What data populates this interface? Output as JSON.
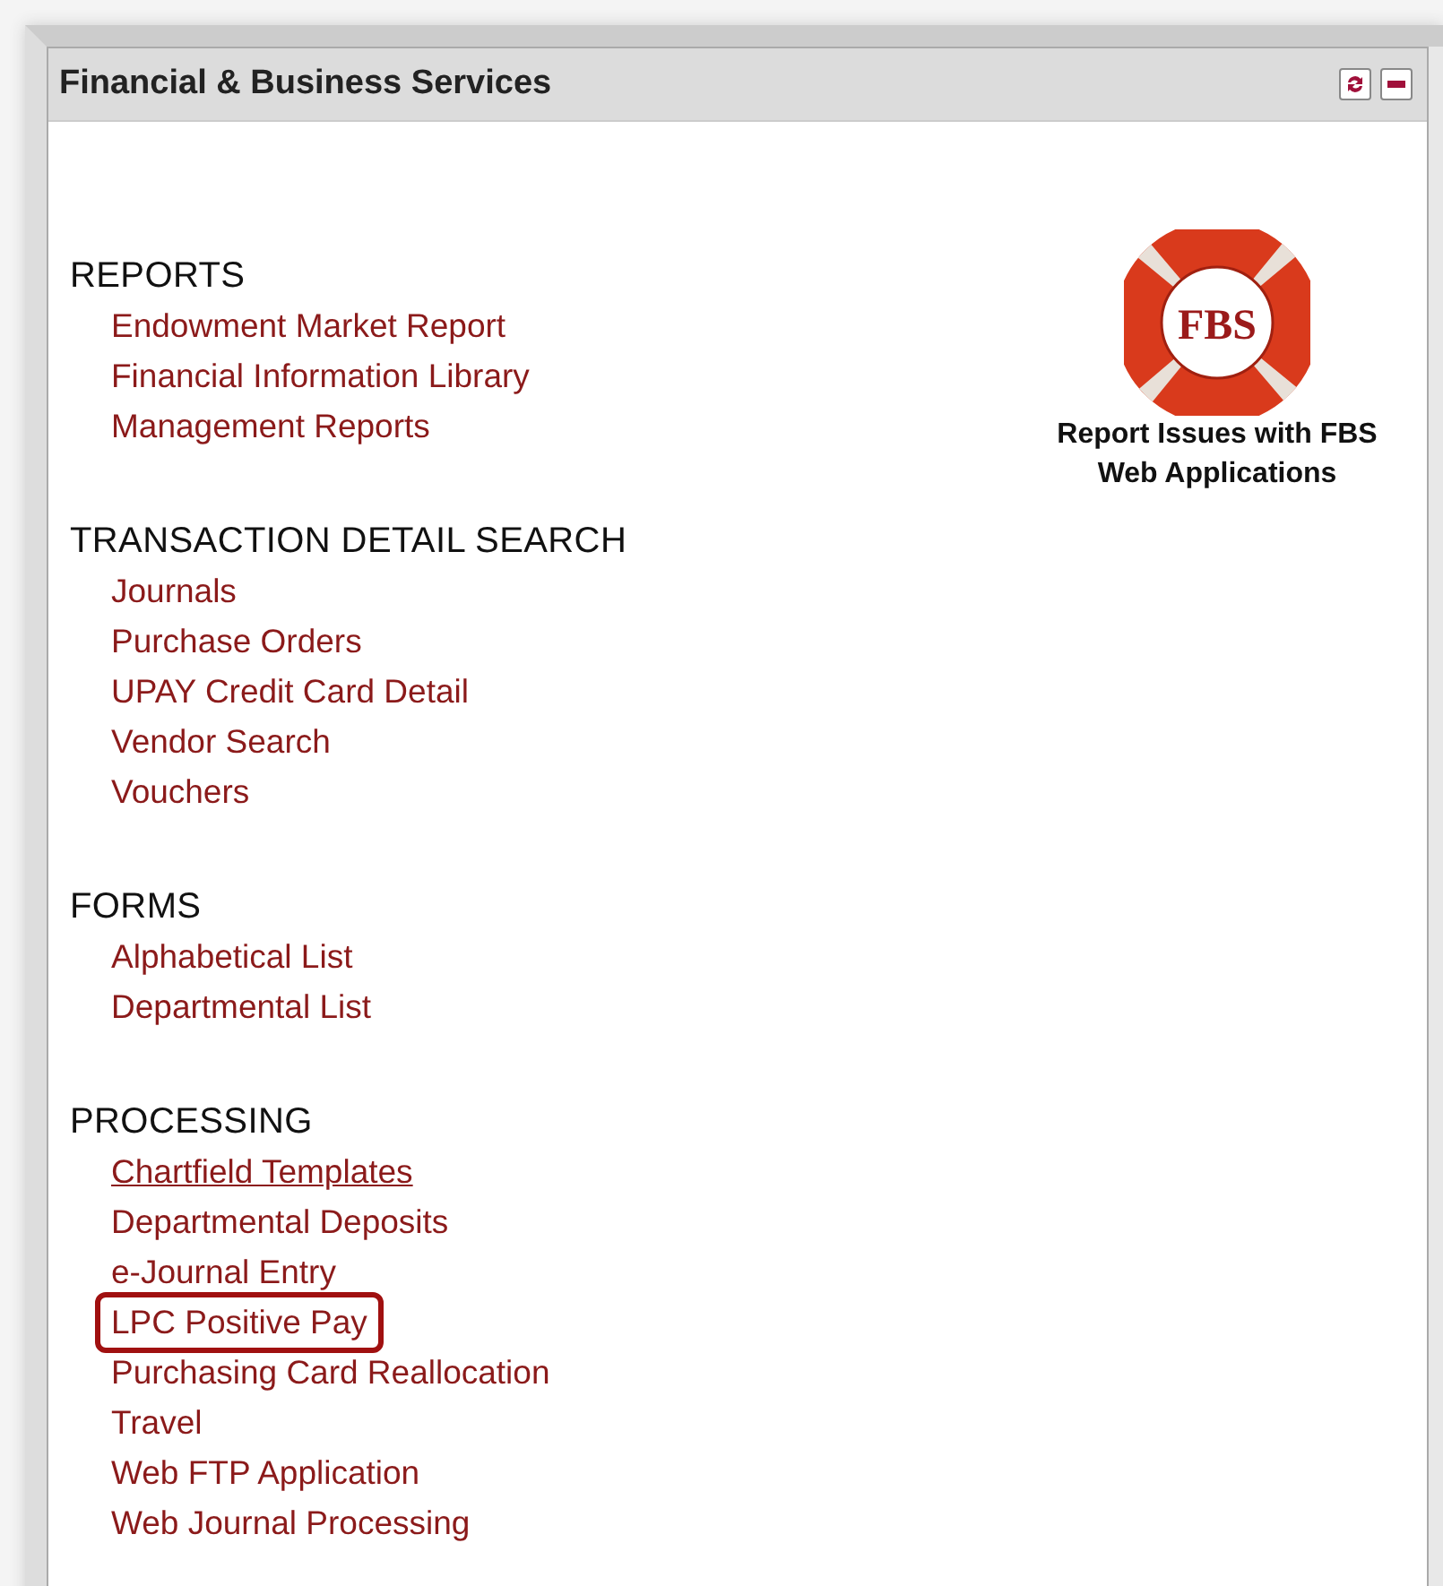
{
  "panel": {
    "title": "Financial & Business Services",
    "buttons": [
      {
        "kind": "refresh"
      },
      {
        "kind": "minimize"
      }
    ]
  },
  "sections": [
    {
      "heading": "REPORTS",
      "links": [
        {
          "label": "Endowment Market Report",
          "underlined": false,
          "highlighted": false
        },
        {
          "label": "Financial Information Library",
          "underlined": false,
          "highlighted": false
        },
        {
          "label": "Management Reports",
          "underlined": false,
          "highlighted": false
        }
      ]
    },
    {
      "heading": "TRANSACTION DETAIL SEARCH",
      "links": [
        {
          "label": "Journals",
          "underlined": false,
          "highlighted": false
        },
        {
          "label": "Purchase Orders",
          "underlined": false,
          "highlighted": false
        },
        {
          "label": "UPAY Credit Card Detail",
          "underlined": false,
          "highlighted": false
        },
        {
          "label": "Vendor Search",
          "underlined": false,
          "highlighted": false
        },
        {
          "label": "Vouchers",
          "underlined": false,
          "highlighted": false
        }
      ]
    },
    {
      "heading": "FORMS",
      "links": [
        {
          "label": "Alphabetical List",
          "underlined": false,
          "highlighted": false
        },
        {
          "label": "Departmental List",
          "underlined": false,
          "highlighted": false
        }
      ]
    },
    {
      "heading": "PROCESSING",
      "links": [
        {
          "label": "Chartfield Templates",
          "underlined": true,
          "highlighted": false
        },
        {
          "label": "Departmental Deposits",
          "underlined": false,
          "highlighted": false
        },
        {
          "label": "e-Journal Entry",
          "underlined": false,
          "highlighted": false
        },
        {
          "label": "LPC Positive Pay",
          "underlined": false,
          "highlighted": true
        },
        {
          "label": "Purchasing Card Reallocation",
          "underlined": false,
          "highlighted": false
        },
        {
          "label": "Travel",
          "underlined": false,
          "highlighted": false
        },
        {
          "label": "Web FTP Application",
          "underlined": false,
          "highlighted": false
        },
        {
          "label": "Web Journal Processing",
          "underlined": false,
          "highlighted": false
        }
      ]
    }
  ],
  "promo": {
    "logo_text": "FBS",
    "caption": "Report Issues with FBS Web Applications"
  }
}
